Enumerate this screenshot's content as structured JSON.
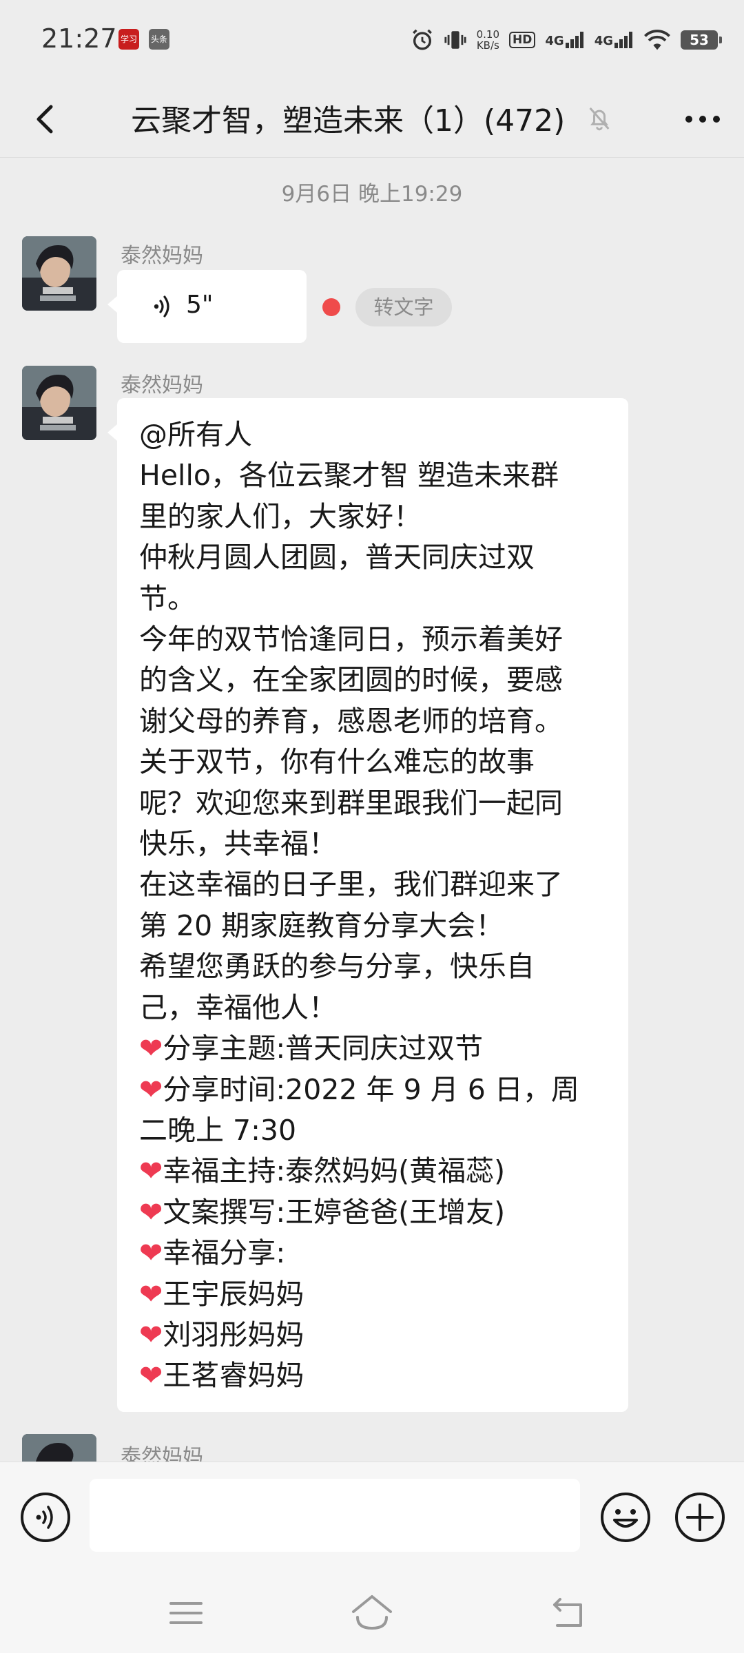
{
  "status_bar": {
    "time": "21:27",
    "app_icon_1": "学习",
    "app_icon_2": "头条",
    "net_speed": "0.10",
    "net_unit": "KB/s",
    "hd_label": "HD",
    "sim1": "4G",
    "sim2": "4G",
    "battery": "53"
  },
  "header": {
    "title": "云聚才智，塑造未来（1）(472)",
    "back_icon": "chevron-left-icon",
    "mute_icon": "bell-off-icon",
    "more_icon": "more-horizontal-icon"
  },
  "timestamp": "9月6日 晚上19:29",
  "messages": [
    {
      "sender": "泰然妈妈",
      "type": "voice",
      "duration": "5\"",
      "convert_label": "转文字",
      "unread": true
    },
    {
      "sender": "泰然妈妈",
      "type": "text",
      "lines": [
        "@所有人",
        "Hello，各位云聚才智 塑造未来群",
        "里的家人们，大家好！",
        "仲秋月圆人团圆，普天同庆过双",
        "节。",
        "今年的双节恰逢同日，预示着美好",
        "的含义，在全家团圆的时候，要感",
        "谢父母的养育，感恩老师的培育。",
        "关于双节，你有什么难忘的故事",
        "呢？欢迎您来到群里跟我们一起同",
        "快乐，共幸福！",
        "在这幸福的日子里，我们群迎来了",
        "第 20 期家庭教育分享大会！",
        "希望您勇跃的参与分享，快乐自",
        "己，幸福他人！",
        "❤分享主题:普天同庆过双节",
        "❤分享时间:2022 年 9 月 6 日，周",
        "二晚上 7:30",
        "❤幸福主持:泰然妈妈(黄福蕊)",
        "❤文案撰写:王婷爸爸(王增友)",
        "❤幸福分享:",
        "❤王宇辰妈妈",
        "❤刘羽彤妈妈",
        "❤王茗睿妈妈"
      ]
    },
    {
      "sender": "泰然妈妈",
      "type": "partial"
    }
  ],
  "input_bar": {
    "placeholder": "",
    "voice_icon": "voice-input-icon",
    "emoji_icon": "emoji-icon",
    "plus_icon": "plus-icon"
  },
  "nav_bar": {
    "menu_icon": "menu-icon",
    "home_icon": "home-icon",
    "back_icon": "back-icon"
  },
  "colors": {
    "background": "#ededed",
    "bubble": "#ffffff",
    "unread_dot": "#ef4b4b",
    "heart": "#ee3a52"
  }
}
